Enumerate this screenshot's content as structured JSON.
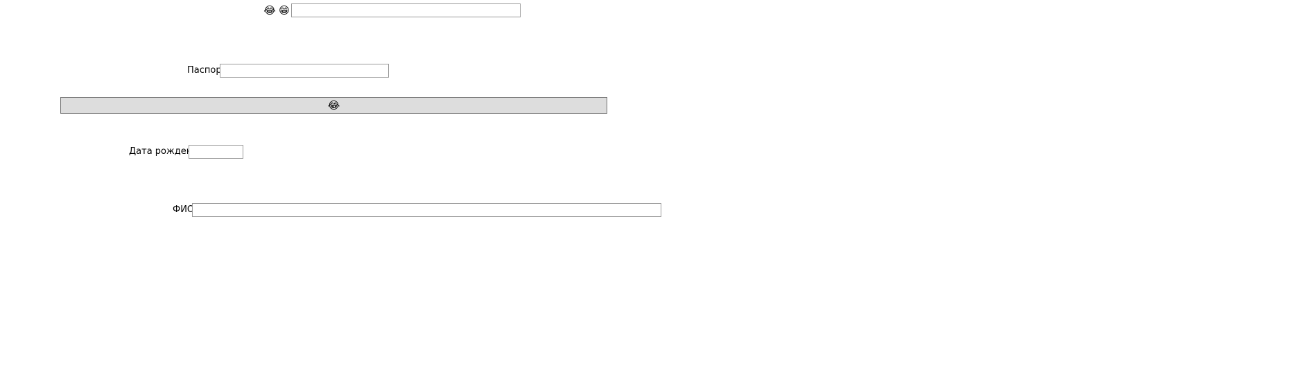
{
  "top_row": {
    "icon_1": "😂",
    "icon_2": "😁",
    "icon_1_name": "laughing-tears-face-icon",
    "icon_2_name": "grinning-face-icon",
    "input_value": ""
  },
  "passport": {
    "label": "Паспорт",
    "value": ""
  },
  "action_button": {
    "label": "😂",
    "icon_name": "laughing-tears-face-icon"
  },
  "birth_date": {
    "label": "Дата рождения",
    "value": ""
  },
  "full_name": {
    "label": "ФИО",
    "value": ""
  },
  "colors": {
    "background": "#ffffff",
    "button_background": "#dddddd",
    "button_border": "#6f6f6f",
    "input_border": "#9a9a9a",
    "text": "#000000"
  }
}
